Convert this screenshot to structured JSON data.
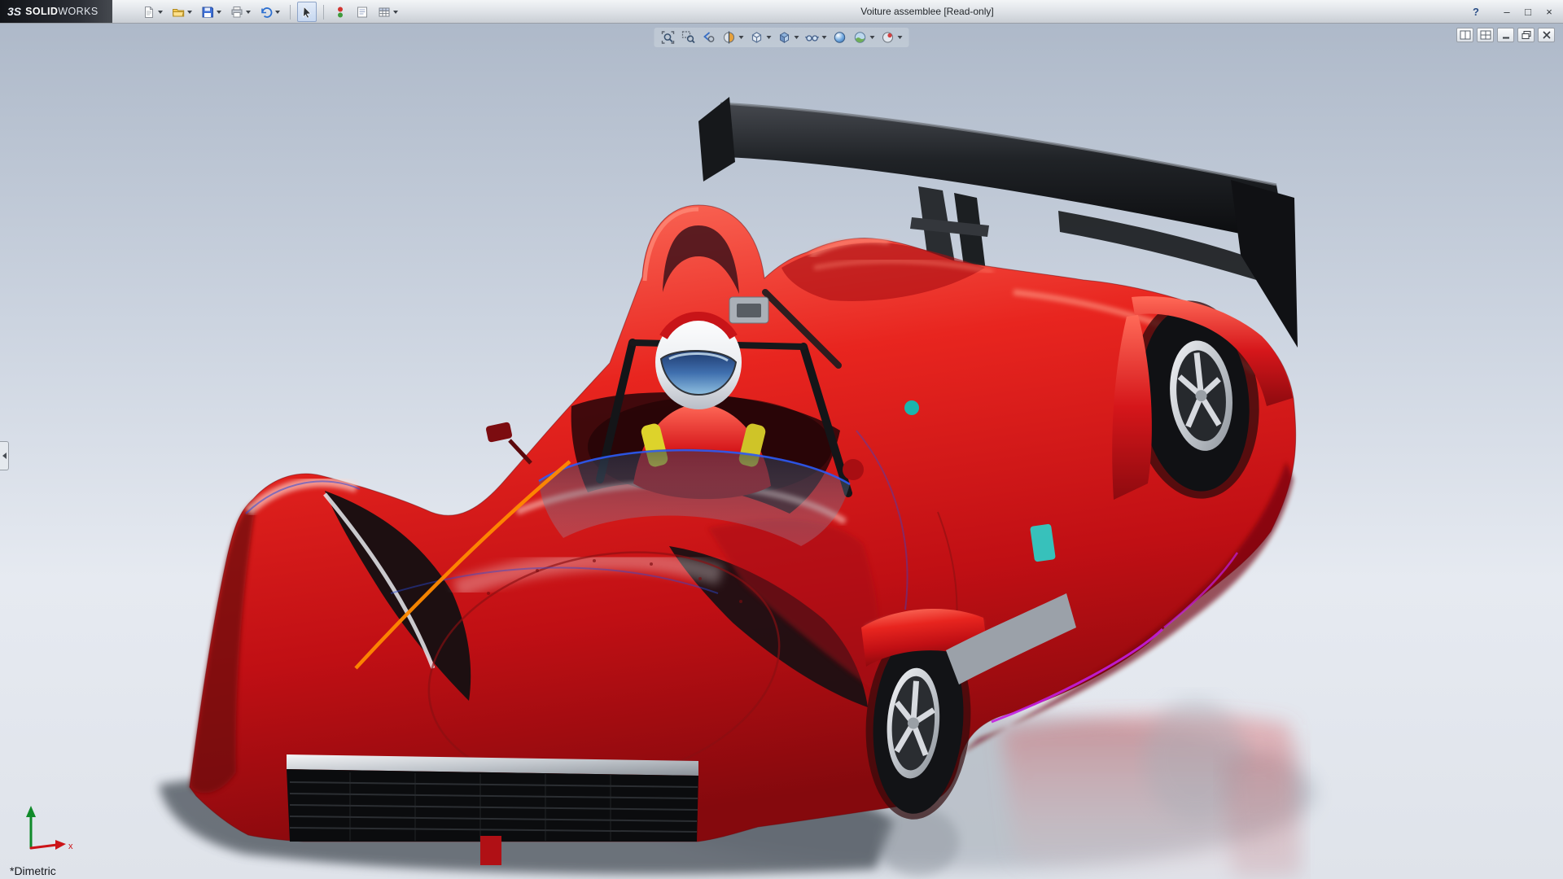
{
  "titlebar": {
    "logo_mark": "3S",
    "logo_bold": "SOLID",
    "logo_light": "WORKS",
    "title": "Voiture assemblee [Read-only]",
    "window_buttons": [
      {
        "name": "help-button",
        "glyph": "?"
      },
      {
        "name": "minimize-window-button",
        "glyph": "–"
      },
      {
        "name": "maximize-window-button",
        "glyph": "□"
      },
      {
        "name": "close-window-button",
        "glyph": "×"
      }
    ]
  },
  "main_toolbar": {
    "items": [
      {
        "name": "new-document",
        "icon": "new-document-icon",
        "dropdown": true
      },
      {
        "name": "open",
        "icon": "open-folder-icon",
        "dropdown": true
      },
      {
        "name": "save",
        "icon": "save-icon",
        "dropdown": true
      },
      {
        "name": "print",
        "icon": "print-icon",
        "dropdown": true
      },
      {
        "name": "undo",
        "icon": "undo-icon",
        "dropdown": true
      },
      {
        "separator": true
      },
      {
        "name": "select",
        "icon": "select-arrow-icon",
        "dropdown": false,
        "pressed": true
      },
      {
        "separator": true
      },
      {
        "name": "appearance-colors",
        "icon": "color-toggle-icon",
        "dropdown": false
      },
      {
        "name": "new-sheet",
        "icon": "sheet-icon",
        "dropdown": false
      },
      {
        "name": "design-table",
        "icon": "grid-icon",
        "dropdown": true
      }
    ]
  },
  "headsup_toolbar": {
    "items": [
      {
        "name": "zoom-to-fit",
        "icon": "zoom-fit-icon",
        "dropdown": false
      },
      {
        "name": "zoom-to-area",
        "icon": "zoom-area-icon",
        "dropdown": false
      },
      {
        "name": "previous-view",
        "icon": "previous-view-icon",
        "dropdown": false
      },
      {
        "name": "section-view",
        "icon": "section-view-icon",
        "dropdown": true
      },
      {
        "name": "view-orientation",
        "icon": "view-orientation-icon",
        "dropdown": true
      },
      {
        "name": "display-style",
        "icon": "display-style-icon",
        "dropdown": true
      },
      {
        "name": "hide-show-items",
        "icon": "hide-show-icon",
        "dropdown": true
      },
      {
        "name": "edit-appearance",
        "icon": "edit-appearance-icon",
        "dropdown": false
      },
      {
        "name": "apply-scene",
        "icon": "apply-scene-icon",
        "dropdown": true
      },
      {
        "name": "view-settings",
        "icon": "view-settings-icon",
        "dropdown": true
      }
    ]
  },
  "document_window_controls": {
    "items": [
      {
        "name": "split-view",
        "icon": "split-view-icon"
      },
      {
        "name": "viewport-layout",
        "icon": "viewport-layout-icon"
      },
      {
        "name": "minimize-document",
        "icon": "minimize-document-icon"
      },
      {
        "name": "restore-document",
        "icon": "restore-document-icon"
      },
      {
        "name": "close-document",
        "icon": "close-document-icon"
      }
    ]
  },
  "viewport": {
    "view_orientation_label": "*Dimetric",
    "triad": {
      "x_label": "x"
    }
  },
  "colors": {
    "body_red": "#cc1016",
    "wing_black": "#121316",
    "background_top": "#aeb9c9",
    "background_bottom": "#e6eaf1",
    "accent_orange": "#ff8a00",
    "accent_magenta": "#c21ee0",
    "accent_cyan": "#2bd0ca",
    "helmet_white": "#f2f4f7"
  }
}
